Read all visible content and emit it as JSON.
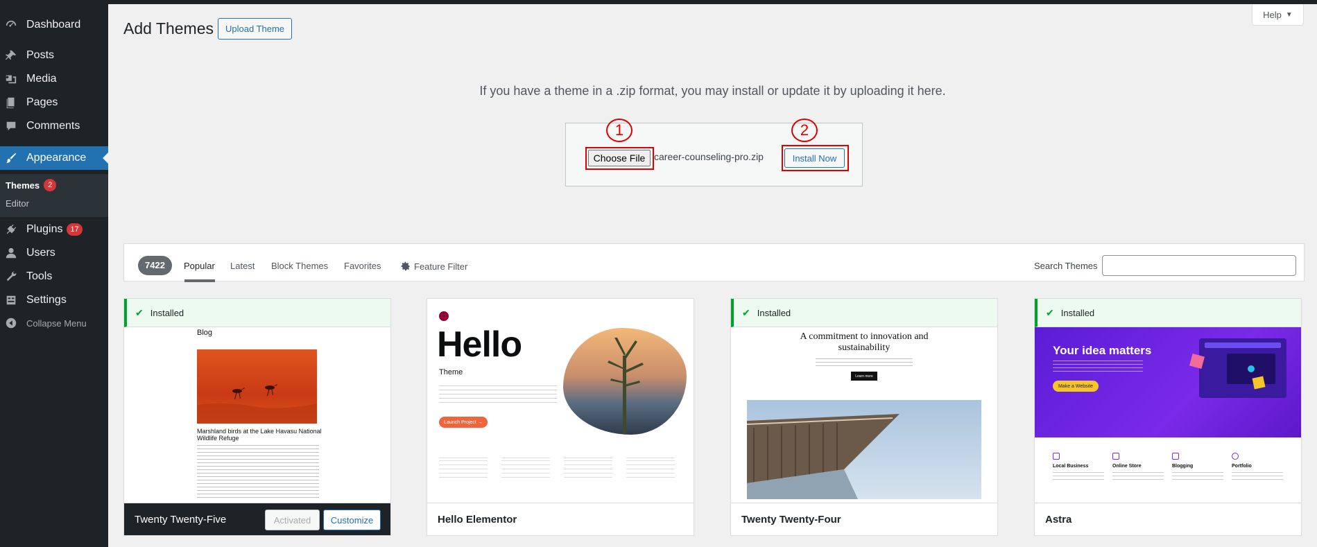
{
  "sidebar": {
    "items": [
      {
        "label": "Dashboard",
        "icon": "dashboard-icon"
      },
      {
        "label": "Posts",
        "icon": "pin-icon"
      },
      {
        "label": "Media",
        "icon": "media-icon"
      },
      {
        "label": "Pages",
        "icon": "pages-icon"
      },
      {
        "label": "Comments",
        "icon": "comments-icon"
      },
      {
        "label": "Appearance",
        "icon": "brush-icon"
      },
      {
        "label": "Plugins",
        "icon": "plugin-icon",
        "badge": "17"
      },
      {
        "label": "Users",
        "icon": "users-icon"
      },
      {
        "label": "Tools",
        "icon": "wrench-icon"
      },
      {
        "label": "Settings",
        "icon": "settings-icon"
      },
      {
        "label": "Collapse Menu",
        "icon": "collapse-icon"
      }
    ],
    "submenu": [
      {
        "label": "Themes",
        "badge": "2"
      },
      {
        "label": "Editor"
      }
    ]
  },
  "header": {
    "title": "Add Themes",
    "upload_button": "Upload Theme",
    "help_button": "Help"
  },
  "upload": {
    "instruction": "If you have a theme in a .zip format, you may install or update it by uploading it here.",
    "choose_file": "Choose File",
    "file_name": "career-counseling-pro.zip",
    "install_now": "Install Now",
    "step1": "1",
    "step2": "2"
  },
  "filter": {
    "count": "7422",
    "tabs": [
      "Popular",
      "Latest",
      "Block Themes",
      "Favorites",
      "Feature Filter"
    ],
    "search_label": "Search Themes",
    "search_value": ""
  },
  "themes": [
    {
      "name": "Twenty Twenty-Five",
      "installed": "Installed",
      "activated": "Activated",
      "customize": "Customize",
      "preview": {
        "heading": "Blog",
        "caption": "Marshland birds at the Lake Havasu National Wildlife Refuge"
      }
    },
    {
      "name": "Hello Elementor",
      "preview": {
        "heading": "Hello",
        "sub": "Theme",
        "button": "Launch Project →"
      }
    },
    {
      "name": "Twenty Twenty-Four",
      "installed": "Installed",
      "preview": {
        "heading": "A commitment to innovation and sustainability",
        "button": "Learn more"
      }
    },
    {
      "name": "Astra",
      "installed": "Installed",
      "preview": {
        "heading": "Your idea matters",
        "button": "Make a Website",
        "features": [
          "Local Business",
          "Online Store",
          "Blogging",
          "Portfolio"
        ]
      }
    }
  ],
  "colors": {
    "sidebar_bg": "#1d2327",
    "accent": "#2271b1",
    "highlight": "#e00000",
    "installed_green": "#00a32a"
  }
}
